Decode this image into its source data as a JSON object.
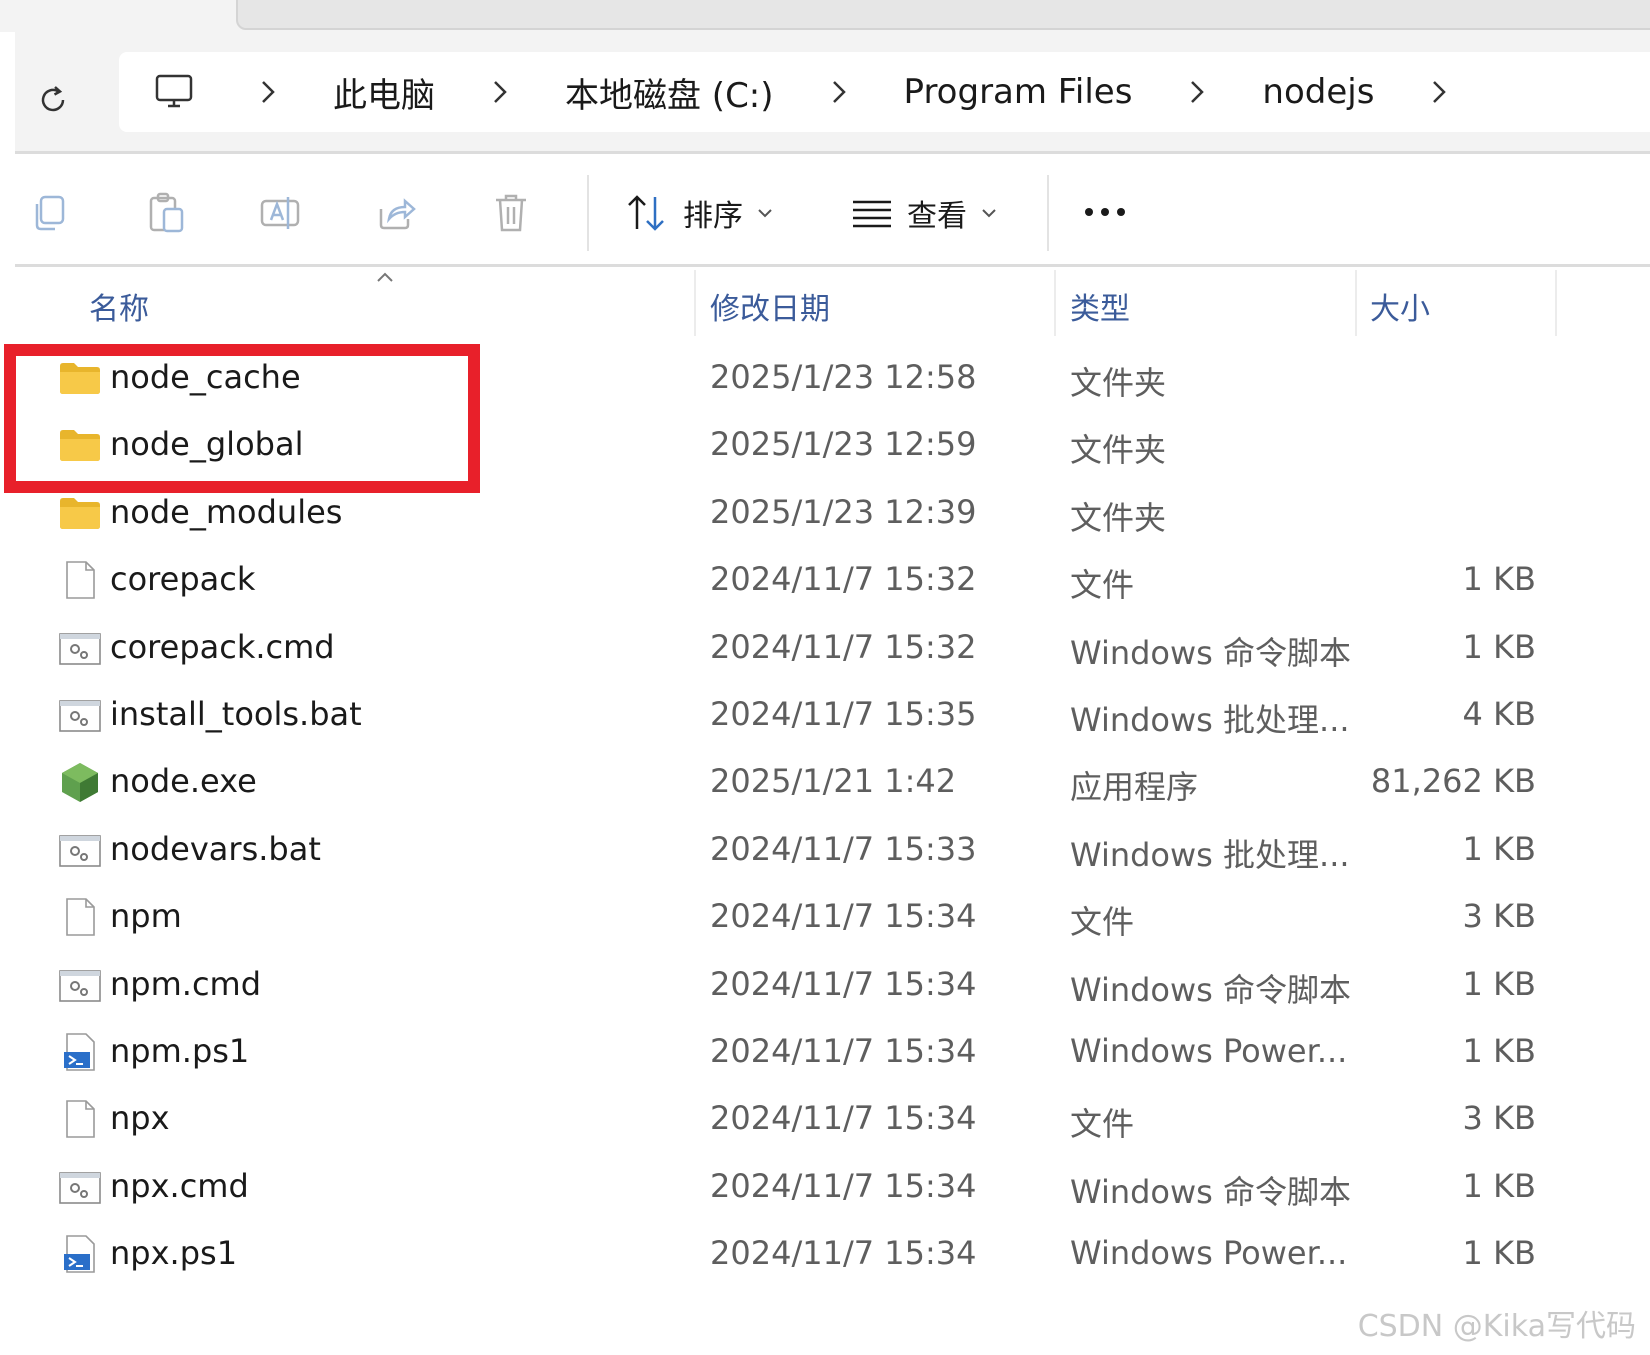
{
  "breadcrumb": {
    "items": [
      "此电脑",
      "本地磁盘 (C:)",
      "Program Files",
      "nodejs"
    ]
  },
  "toolbar": {
    "sort_label": "排序",
    "view_label": "查看"
  },
  "columns": {
    "name": "名称",
    "modified": "修改日期",
    "type": "类型",
    "size": "大小"
  },
  "files": [
    {
      "name": "node_cache",
      "modified": "2025/1/23 12:58",
      "type": "文件夹",
      "size": "",
      "icon": "folder-icon"
    },
    {
      "name": "node_global",
      "modified": "2025/1/23 12:59",
      "type": "文件夹",
      "size": "",
      "icon": "folder-icon"
    },
    {
      "name": "node_modules",
      "modified": "2025/1/23 12:39",
      "type": "文件夹",
      "size": "",
      "icon": "folder-icon"
    },
    {
      "name": "corepack",
      "modified": "2024/11/7 15:32",
      "type": "文件",
      "size": "1 KB",
      "icon": "file-icon"
    },
    {
      "name": "corepack.cmd",
      "modified": "2024/11/7 15:32",
      "type": "Windows 命令脚本",
      "size": "1 KB",
      "icon": "script-icon"
    },
    {
      "name": "install_tools.bat",
      "modified": "2024/11/7 15:35",
      "type": "Windows 批处理...",
      "size": "4 KB",
      "icon": "script-icon"
    },
    {
      "name": "node.exe",
      "modified": "2025/1/21 1:42",
      "type": "应用程序",
      "size": "81,262 KB",
      "icon": "nodejs-icon"
    },
    {
      "name": "nodevars.bat",
      "modified": "2024/11/7 15:33",
      "type": "Windows 批处理...",
      "size": "1 KB",
      "icon": "script-icon"
    },
    {
      "name": "npm",
      "modified": "2024/11/7 15:34",
      "type": "文件",
      "size": "3 KB",
      "icon": "file-icon"
    },
    {
      "name": "npm.cmd",
      "modified": "2024/11/7 15:34",
      "type": "Windows 命令脚本",
      "size": "1 KB",
      "icon": "script-icon"
    },
    {
      "name": "npm.ps1",
      "modified": "2024/11/7 15:34",
      "type": "Windows Power...",
      "size": "1 KB",
      "icon": "powershell-icon"
    },
    {
      "name": "npx",
      "modified": "2024/11/7 15:34",
      "type": "文件",
      "size": "3 KB",
      "icon": "file-icon"
    },
    {
      "name": "npx.cmd",
      "modified": "2024/11/7 15:34",
      "type": "Windows 命令脚本",
      "size": "1 KB",
      "icon": "script-icon"
    },
    {
      "name": "npx.ps1",
      "modified": "2024/11/7 15:34",
      "type": "Windows Power...",
      "size": "1 KB",
      "icon": "powershell-icon"
    }
  ],
  "watermark": "CSDN @Kika写代码",
  "colors": {
    "highlight": "#e8202a",
    "folder": "#f7c948",
    "node_green": "#5fa04e",
    "header_text": "#3b5b9a"
  }
}
